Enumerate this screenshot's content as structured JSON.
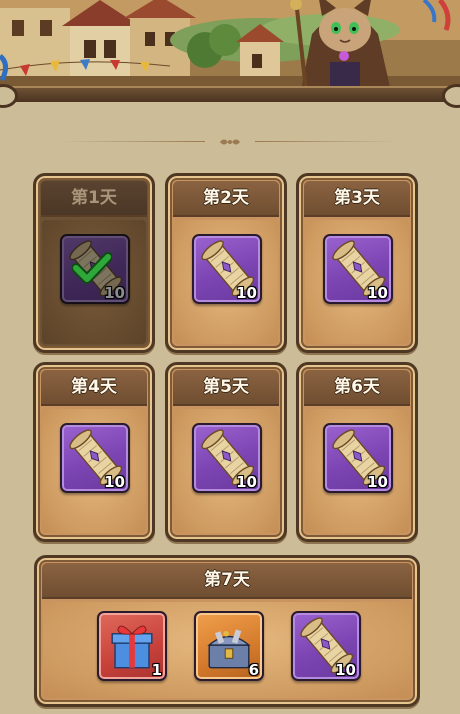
{
  "days": [
    {
      "label": "第1天",
      "claimed": true,
      "reward": {
        "icon": "scroll-icon",
        "qty": "10"
      }
    },
    {
      "label": "第2天",
      "claimed": false,
      "reward": {
        "icon": "scroll-icon",
        "qty": "10"
      }
    },
    {
      "label": "第3天",
      "claimed": false,
      "reward": {
        "icon": "scroll-icon",
        "qty": "10"
      }
    },
    {
      "label": "第4天",
      "claimed": false,
      "reward": {
        "icon": "scroll-icon",
        "qty": "10"
      }
    },
    {
      "label": "第5天",
      "claimed": false,
      "reward": {
        "icon": "scroll-icon",
        "qty": "10"
      }
    },
    {
      "label": "第6天",
      "claimed": false,
      "reward": {
        "icon": "scroll-icon",
        "qty": "10"
      }
    }
  ],
  "day7": {
    "label": "第7天",
    "rewards": [
      {
        "icon": "gift-box-icon",
        "qty": "1",
        "frame": "red"
      },
      {
        "icon": "treasure-chest-icon",
        "qty": "6",
        "frame": "orange"
      },
      {
        "icon": "scroll-icon",
        "qty": "10",
        "frame": "purple"
      }
    ]
  },
  "colors": {
    "background": "#cdbc98",
    "card": "#c9945f",
    "card_header": "#7a5637",
    "claimed_card": "#6b5234",
    "item_purple": "#7b44b2",
    "checkmark": "#2fa83a"
  }
}
